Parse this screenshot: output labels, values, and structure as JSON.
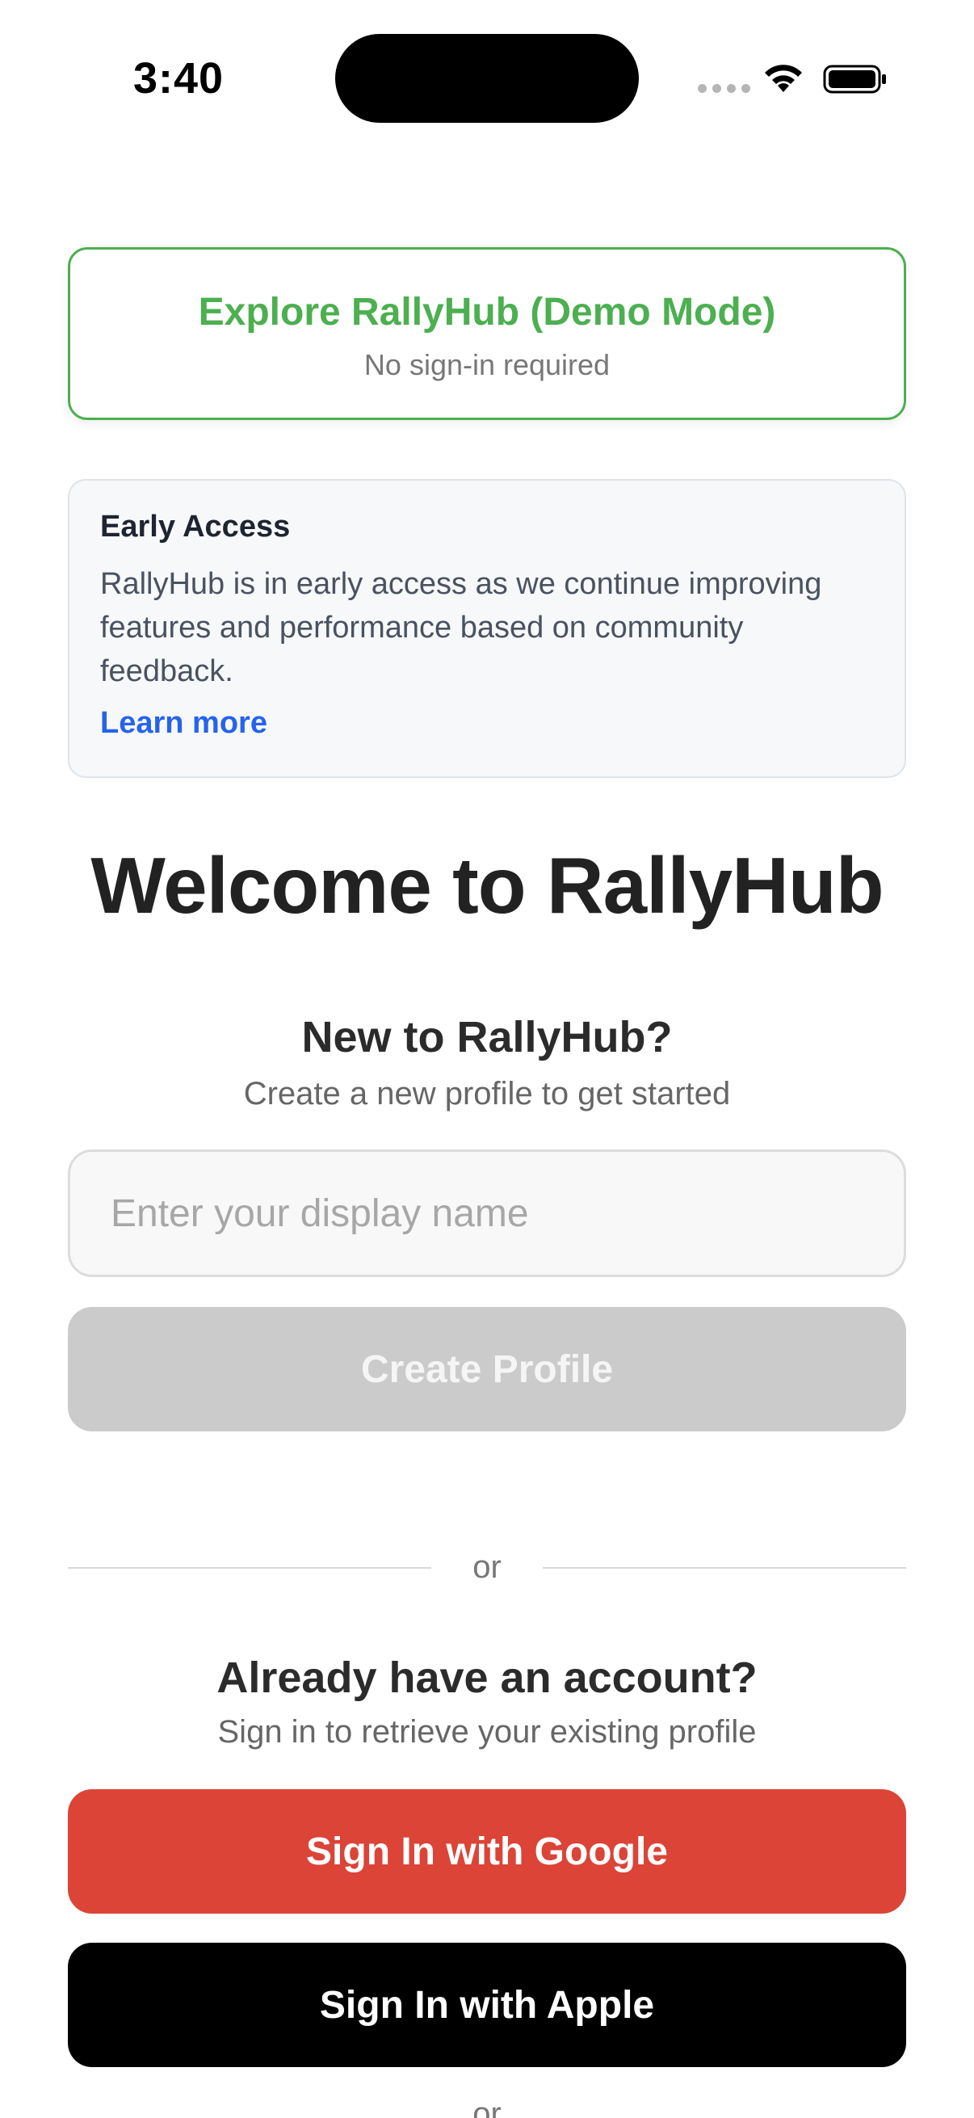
{
  "status_bar": {
    "time": "3:40"
  },
  "demo": {
    "title": "Explore RallyHub (Demo Mode)",
    "subtitle": "No sign-in required"
  },
  "early_access": {
    "title": "Early Access",
    "body": "RallyHub is in early access as we continue improving features and performance based on community feedback.",
    "link": "Learn more"
  },
  "welcome": "Welcome to RallyHub",
  "new_user": {
    "title": "New to RallyHub?",
    "subtitle": "Create a new profile to get started",
    "input_placeholder": "Enter your display name",
    "input_value": "",
    "create_button": "Create Profile"
  },
  "divider_text": "or",
  "existing_user": {
    "title": "Already have an account?",
    "subtitle": "Sign in to retrieve your existing profile",
    "google_button": "Sign In with Google",
    "apple_button": "Sign In with Apple"
  },
  "bottom_divider_text": "or",
  "colors": {
    "demo_green": "#4caf50",
    "link_blue": "#2563eb",
    "google_red": "#db4437",
    "apple_black": "#000000",
    "disabled_gray": "#cbcbcb"
  },
  "icons": [
    "signal-dots-icon",
    "wifi-icon",
    "battery-icon"
  ]
}
